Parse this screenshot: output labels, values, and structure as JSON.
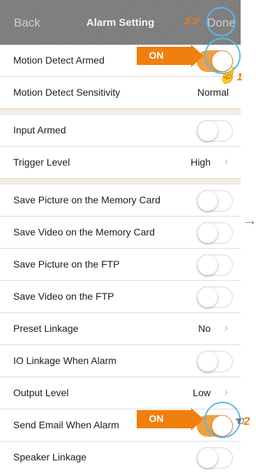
{
  "nav": {
    "back_label": "Back",
    "title": "Alarm Setting",
    "done_label": "Done"
  },
  "groups": [
    [
      {
        "label": "Motion Detect Armed",
        "toggle": true
      },
      {
        "label": "Motion Detect Sensitivity",
        "value": "Normal"
      }
    ],
    [
      {
        "label": "Input Armed",
        "toggle": false
      },
      {
        "label": "Trigger Level",
        "value": "High",
        "chevron": true
      }
    ],
    [
      {
        "label": "Save Picture on the Memory Card",
        "toggle": false
      },
      {
        "label": "Save Video on the Memory Card",
        "toggle": false
      },
      {
        "label": "Save Picture on the FTP",
        "toggle": false
      },
      {
        "label": "Save Video on the FTP",
        "toggle": false
      },
      {
        "label": "Preset Linkage",
        "value": "No",
        "chevron": true
      },
      {
        "label": "IO Linkage When Alarm",
        "toggle": false
      },
      {
        "label": "Output Level",
        "value": "Low",
        "chevron": true
      },
      {
        "label": "Send Email When Alarm",
        "toggle": true
      },
      {
        "label": "Speaker Linkage",
        "toggle": false
      }
    ]
  ],
  "annotations": {
    "callout_1": "ON",
    "callout_2": "ON",
    "step_1": "1",
    "step_2": "2",
    "step_3": "3"
  },
  "colors": {
    "accent_orange": "#f07f0e",
    "toggle_on": "#f0a040",
    "highlight_ring": "#5ab8e6"
  }
}
